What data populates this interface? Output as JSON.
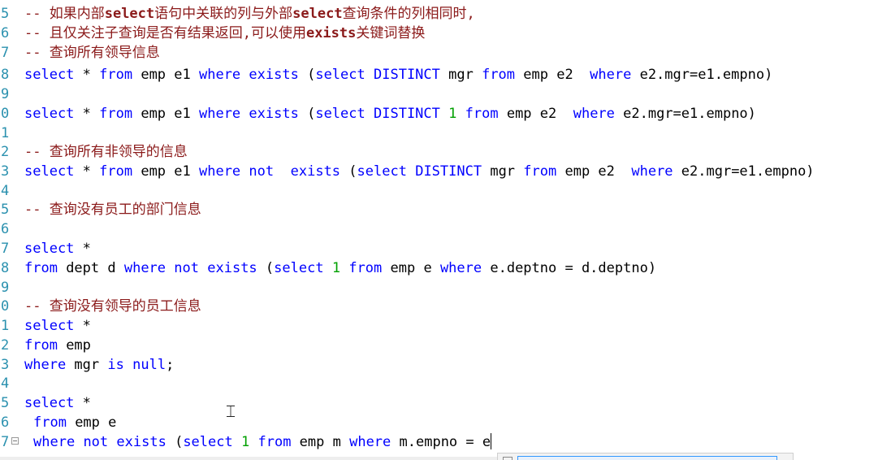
{
  "editor": {
    "line_numbers": [
      "4",
      "5",
      "6",
      "7",
      "8",
      "9",
      "0",
      "1",
      "2",
      "3",
      "4",
      "5",
      "6",
      "7",
      "8",
      "9",
      "0",
      "1",
      "2",
      "3",
      "4",
      "5",
      "6",
      "7"
    ],
    "comments": {
      "c1_a": "-- 如果内部",
      "c1_b": "select",
      "c1_c": "语句中关联的列与外部",
      "c1_d": "select",
      "c1_e": "查询条件的列相同时,",
      "c2_a": "-- 且仅关注子查询是否有结果返回,可以使用",
      "c2_b": "exists",
      "c2_c": "关键词替换",
      "c3": "-- 查询所有领导信息",
      "c4": "-- 查询所有非领导的信息",
      "c5": "-- 查询没有员工的部门信息",
      "c6": "-- 查询没有领导的员工信息"
    },
    "tokens": {
      "select": "select",
      "star": " * ",
      "from": "from",
      "where": "where",
      "exists": "exists",
      "not": "not",
      "distinct": "DISTINCT",
      "is": "is",
      "null": "null",
      "one": "1"
    },
    "text": {
      "l8_a": " emp e1 ",
      "l8_b": " (",
      "l8_c": " mgr ",
      "l8_d": " emp e2  ",
      "l8_e": " e2.mgr=e1.empno)",
      "l10_c": " ",
      "l13_a": " emp e1 ",
      "l13_b": "  ",
      "l13_c": " (",
      "l17_a": " *",
      "l18_a": " dept d ",
      "l18_b": " (",
      "l18_c": " emp e ",
      "l18_d": " e.deptno = d.deptno)",
      "l22_a": " emp",
      "l23_a": " mgr ",
      "l23_b": ";",
      "l26_a": " emp e",
      "l27_a": " (",
      "l27_b": " emp m ",
      "l27_c": " m.empno = e"
    }
  }
}
